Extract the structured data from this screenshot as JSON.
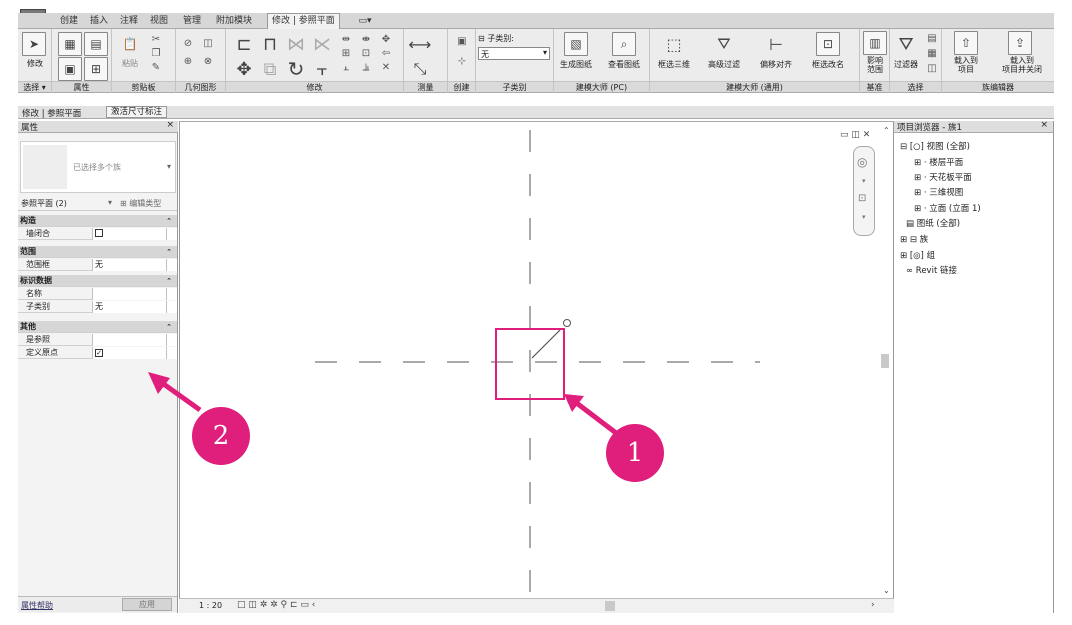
{
  "ribbon": {
    "tabs": [
      "创建",
      "插入",
      "注释",
      "视图",
      "管理",
      "附加模块",
      "修改 | 参照平面"
    ],
    "panels": {
      "select": "选择 ▾",
      "properties": "属性",
      "clipboard": "剪贴板",
      "geometry": "几何图形",
      "modify": "修改",
      "measure": "测量",
      "create": "创建",
      "subcategory": "子类别",
      "build_pc": "建模大师 (PC)",
      "build_general": "建模大师 (通用)",
      "datum": "基准",
      "selection": "选择",
      "family_editor": "族编辑器"
    },
    "buttons": {
      "modify": "修改",
      "paste": "粘贴",
      "subcategory_label": "子类别:",
      "subcategory_value": "无",
      "generate_drawing": "生成图纸",
      "view_drawing": "查看图纸",
      "box_3d": "框选三维",
      "advanced_filter": "高级过滤",
      "offset_align": "偏移对齐",
      "box_rename": "框选改名",
      "affect_range": "影响\n范围",
      "filter": "过滤器",
      "load_project": "载入到\n项目",
      "load_close": "载入到\n项目并关闭"
    }
  },
  "subbar": {
    "context": "修改 | 参照平面",
    "activate": "激活尺寸标注"
  },
  "properties": {
    "title": "属性",
    "selector": "已选择多个族",
    "instance_filter": "参照平面 (2)",
    "edit_type": "编辑类型",
    "groups": [
      {
        "name": "构造",
        "rows": [
          {
            "label": "墙闭合",
            "value": "",
            "check": "unchecked"
          }
        ]
      },
      {
        "name": "范围",
        "rows": [
          {
            "label": "范围框",
            "value": "无"
          }
        ]
      },
      {
        "name": "标识数据",
        "rows": [
          {
            "label": "名称",
            "value": ""
          },
          {
            "label": "子类别",
            "value": "无"
          }
        ]
      },
      {
        "name": "其他",
        "rows": [
          {
            "label": "是参照",
            "value": ""
          },
          {
            "label": "定义原点",
            "value": "",
            "check": "checked"
          }
        ]
      }
    ],
    "help": "属性帮助",
    "apply": "应用"
  },
  "browser": {
    "title": "项目浏览器 - 族1",
    "items": [
      "视图 (全部)",
      "楼层平面",
      "天花板平面",
      "三维视图",
      "立面 (立面 1)",
      "图纸 (全部)",
      "族",
      "组",
      "Revit 链接"
    ]
  },
  "canvas": {
    "scale": "1 : 20"
  },
  "callouts": [
    "1",
    "2"
  ],
  "colors": {
    "accent": "#e01e7b"
  }
}
